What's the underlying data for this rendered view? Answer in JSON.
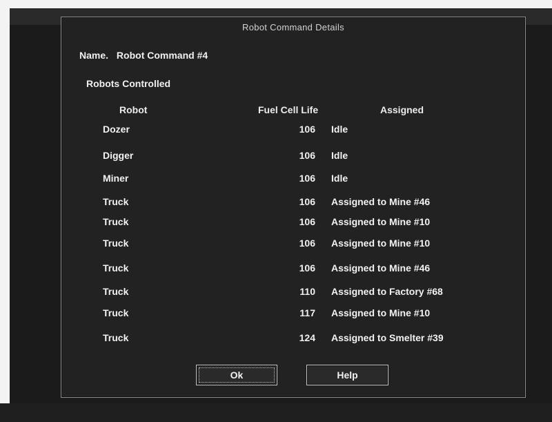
{
  "dialog": {
    "title": "Robot Command Details",
    "name_label": "Name.",
    "name_value": "Robot Command #4",
    "section_label": "Robots Controlled",
    "columns": [
      "Robot",
      "Fuel Cell Life",
      "Assigned"
    ],
    "rows": [
      {
        "robot": "Dozer",
        "fuel": "106",
        "assigned": "Idle"
      },
      {
        "robot": "Digger",
        "fuel": "106",
        "assigned": "Idle"
      },
      {
        "robot": "Miner",
        "fuel": "106",
        "assigned": "Idle"
      },
      {
        "robot": "Truck",
        "fuel": "106",
        "assigned": "Assigned to Mine #46"
      },
      {
        "robot": "Truck",
        "fuel": "106",
        "assigned": "Assigned to Mine #10"
      },
      {
        "robot": "Truck",
        "fuel": "106",
        "assigned": "Assigned to Mine #10"
      },
      {
        "robot": "Truck",
        "fuel": "106",
        "assigned": "Assigned to Mine #46"
      },
      {
        "robot": "Truck",
        "fuel": "110",
        "assigned": "Assigned to Factory #68"
      },
      {
        "robot": "Truck",
        "fuel": "117",
        "assigned": "Assigned to Mine #10"
      },
      {
        "robot": "Truck",
        "fuel": "124",
        "assigned": "Assigned to Smelter #39"
      }
    ],
    "buttons": {
      "ok": "Ok",
      "help": "Help"
    }
  }
}
